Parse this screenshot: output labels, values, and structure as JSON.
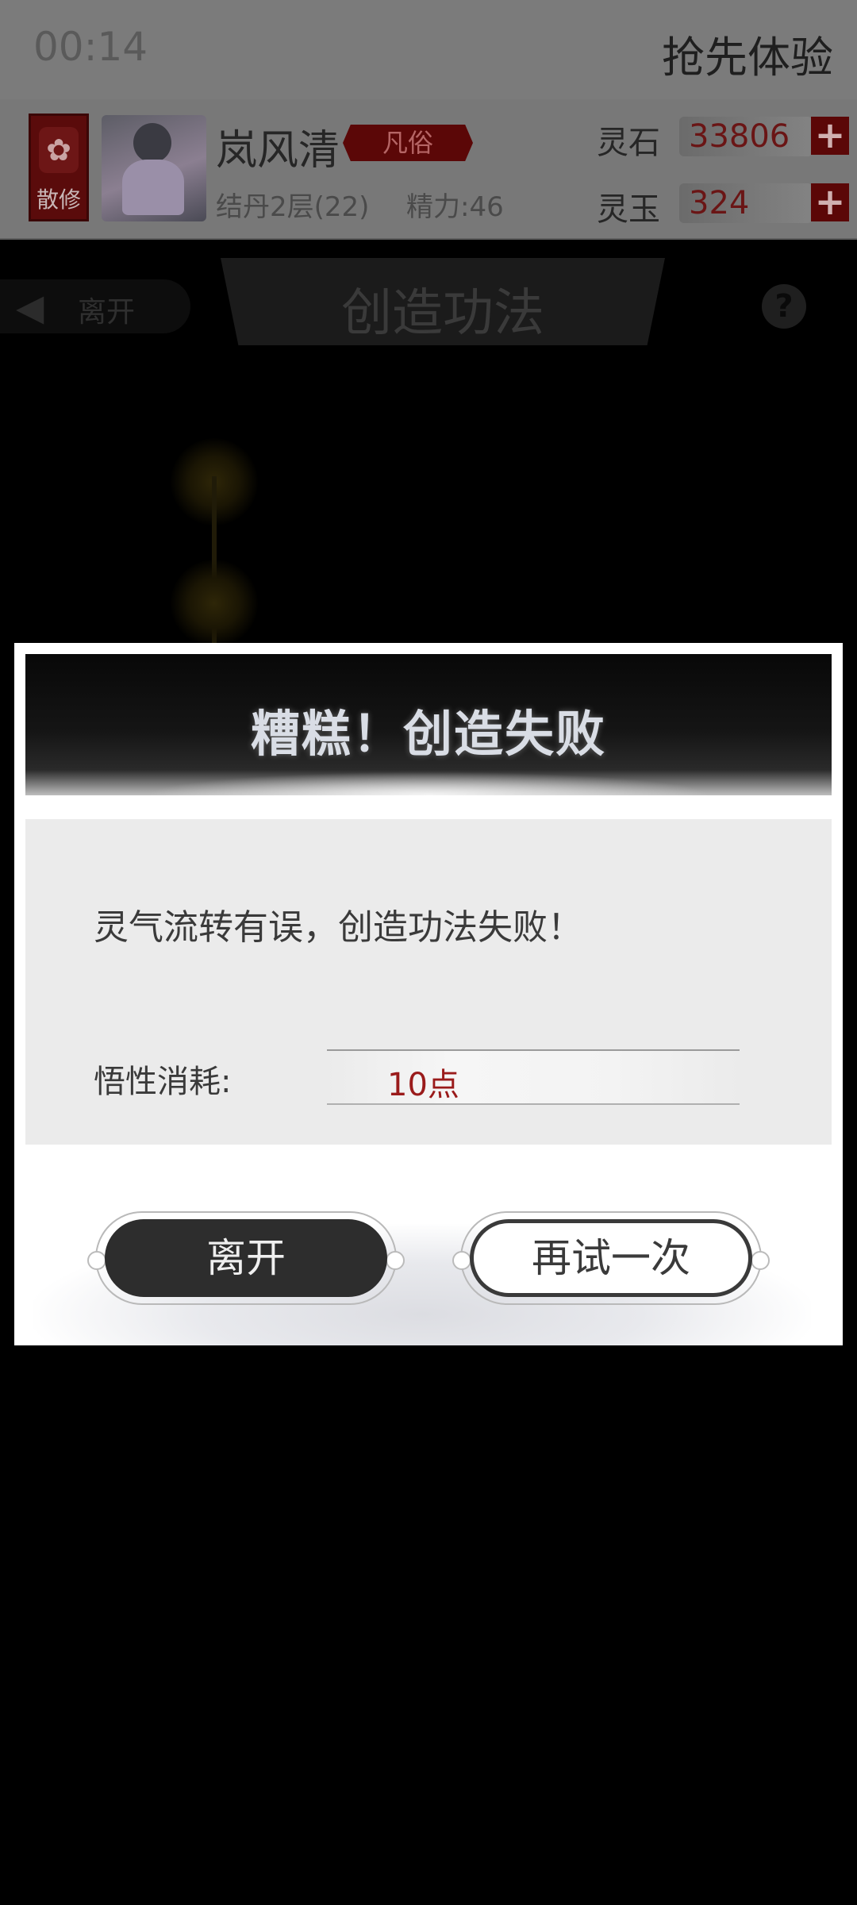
{
  "status_bar": {
    "time": "00:14",
    "right_text": "抢先体验"
  },
  "profile": {
    "sect_label": "散修",
    "name": "岚风清",
    "rank": "凡俗",
    "realm": "结丹2层(22)",
    "energy": "精力:46"
  },
  "resources": [
    {
      "label": "灵石",
      "value": "33806"
    },
    {
      "label": "灵玉",
      "value": "324"
    }
  ],
  "page_header": {
    "back_label": "离开",
    "title": "创造功法",
    "help_symbol": "?"
  },
  "dialog": {
    "title": "糟糕！创造失败",
    "message": "灵气流转有误，创造功法失败！",
    "cost_label": "悟性消耗:",
    "cost_value": "10点",
    "leave_button": "离开",
    "retry_button": "再试一次"
  },
  "colors": {
    "accent_red": "#9a1b1b",
    "dark_button": "#2d2d2d",
    "sect_red": "#5a0b0b"
  }
}
